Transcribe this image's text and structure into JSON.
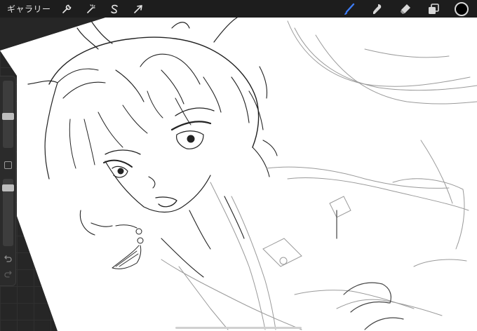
{
  "topbar": {
    "gallery_label": "ギャラリー",
    "left_tools": [
      {
        "name": "actions",
        "icon": "wrench-icon"
      },
      {
        "name": "adjustments",
        "icon": "magic-wand-icon"
      },
      {
        "name": "selection",
        "icon": "selection-s-icon"
      },
      {
        "name": "transform",
        "icon": "arrow-cursor-icon"
      }
    ],
    "right_tools": [
      {
        "name": "brush",
        "icon": "brush-icon",
        "active": true
      },
      {
        "name": "smudge",
        "icon": "smudge-icon"
      },
      {
        "name": "eraser",
        "icon": "eraser-icon"
      },
      {
        "name": "layers",
        "icon": "layers-icon"
      }
    ],
    "active_color": "#000000",
    "accent": "#3d7cf5"
  },
  "sidebar": {
    "brush_size_level": 0.5,
    "opacity_level": 0.15
  }
}
